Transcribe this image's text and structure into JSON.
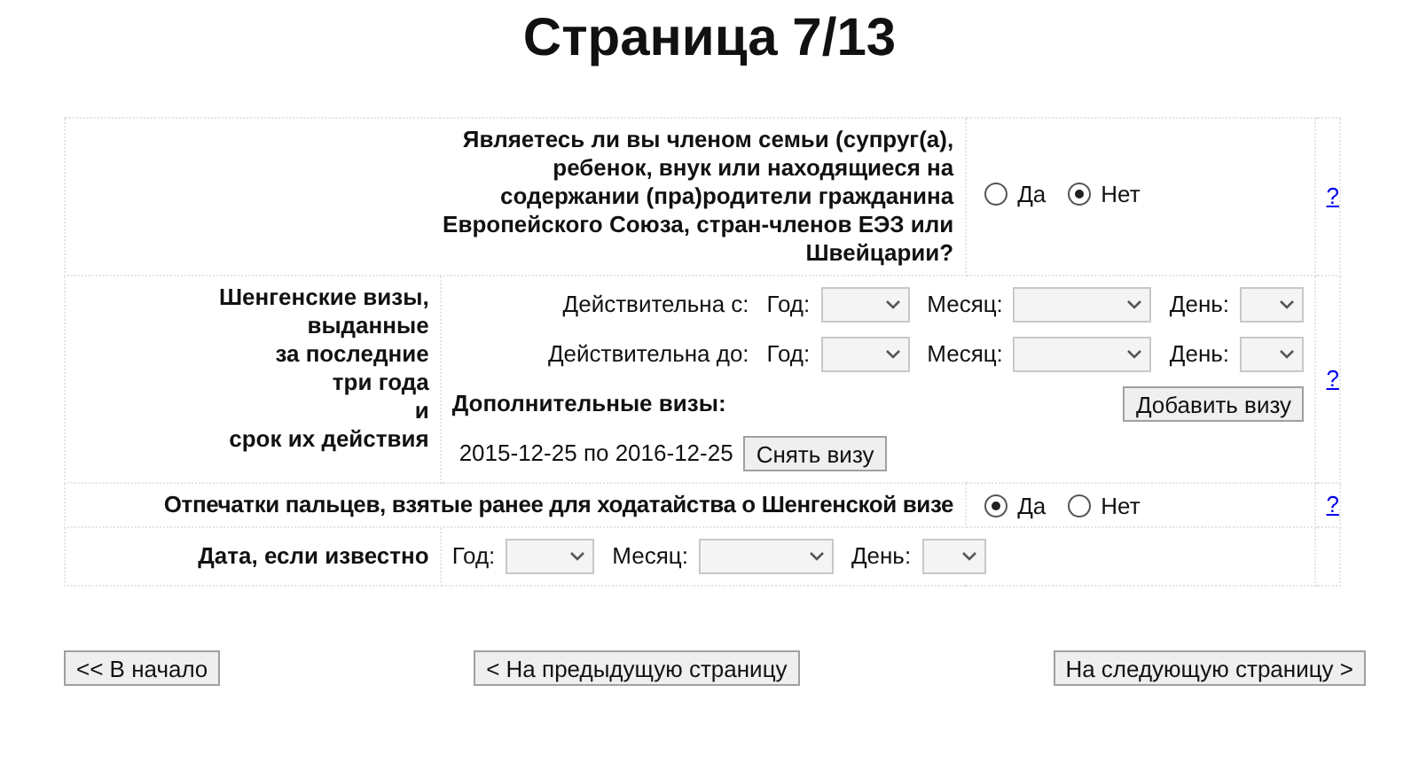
{
  "title": "Страница 7/13",
  "rows": [
    {
      "kind": "radio",
      "label": "Являетесь ли вы членом семьи (супруг(а), ребенок, внук или находящиеся на содержании (пра)родители гражданина Европейского Союза, стран-членов ЕЭЗ или Швейцарии?",
      "options": [
        {
          "label": "Да",
          "selected": false
        },
        {
          "label": "Нет",
          "selected": true
        }
      ],
      "help": "?"
    },
    {
      "kind": "visas",
      "label_lines": [
        "Шенгенские визы,",
        "выданные",
        "за последние",
        "три года",
        "и",
        "срок их действия"
      ],
      "dates": [
        {
          "label": "Действительна с:",
          "year": "Год:",
          "month": "Месяц:",
          "day": "День:"
        },
        {
          "label": "Действительна до:",
          "year": "Год:",
          "month": "Месяц:",
          "day": "День:"
        }
      ],
      "extra_label": "Дополнительные визы:",
      "add_button": "Добавить визу",
      "visas": [
        {
          "period": "2015-12-25 по 2016-12-25",
          "remove_button": "Снять визу"
        }
      ],
      "help": "?"
    },
    {
      "kind": "radio",
      "label": "Отпечатки пальцев, взятые ранее для ходатайства о Шенгенской визе",
      "options": [
        {
          "label": "Да",
          "selected": true
        },
        {
          "label": "Нет",
          "selected": false
        }
      ],
      "help": "?"
    },
    {
      "kind": "date",
      "label": "Дата, если известно",
      "year": "Год:",
      "month": "Месяц:",
      "day": "День:"
    }
  ],
  "nav": [
    "<< В начало",
    "< На предыдущую страницу",
    "На следующую страницу >"
  ]
}
